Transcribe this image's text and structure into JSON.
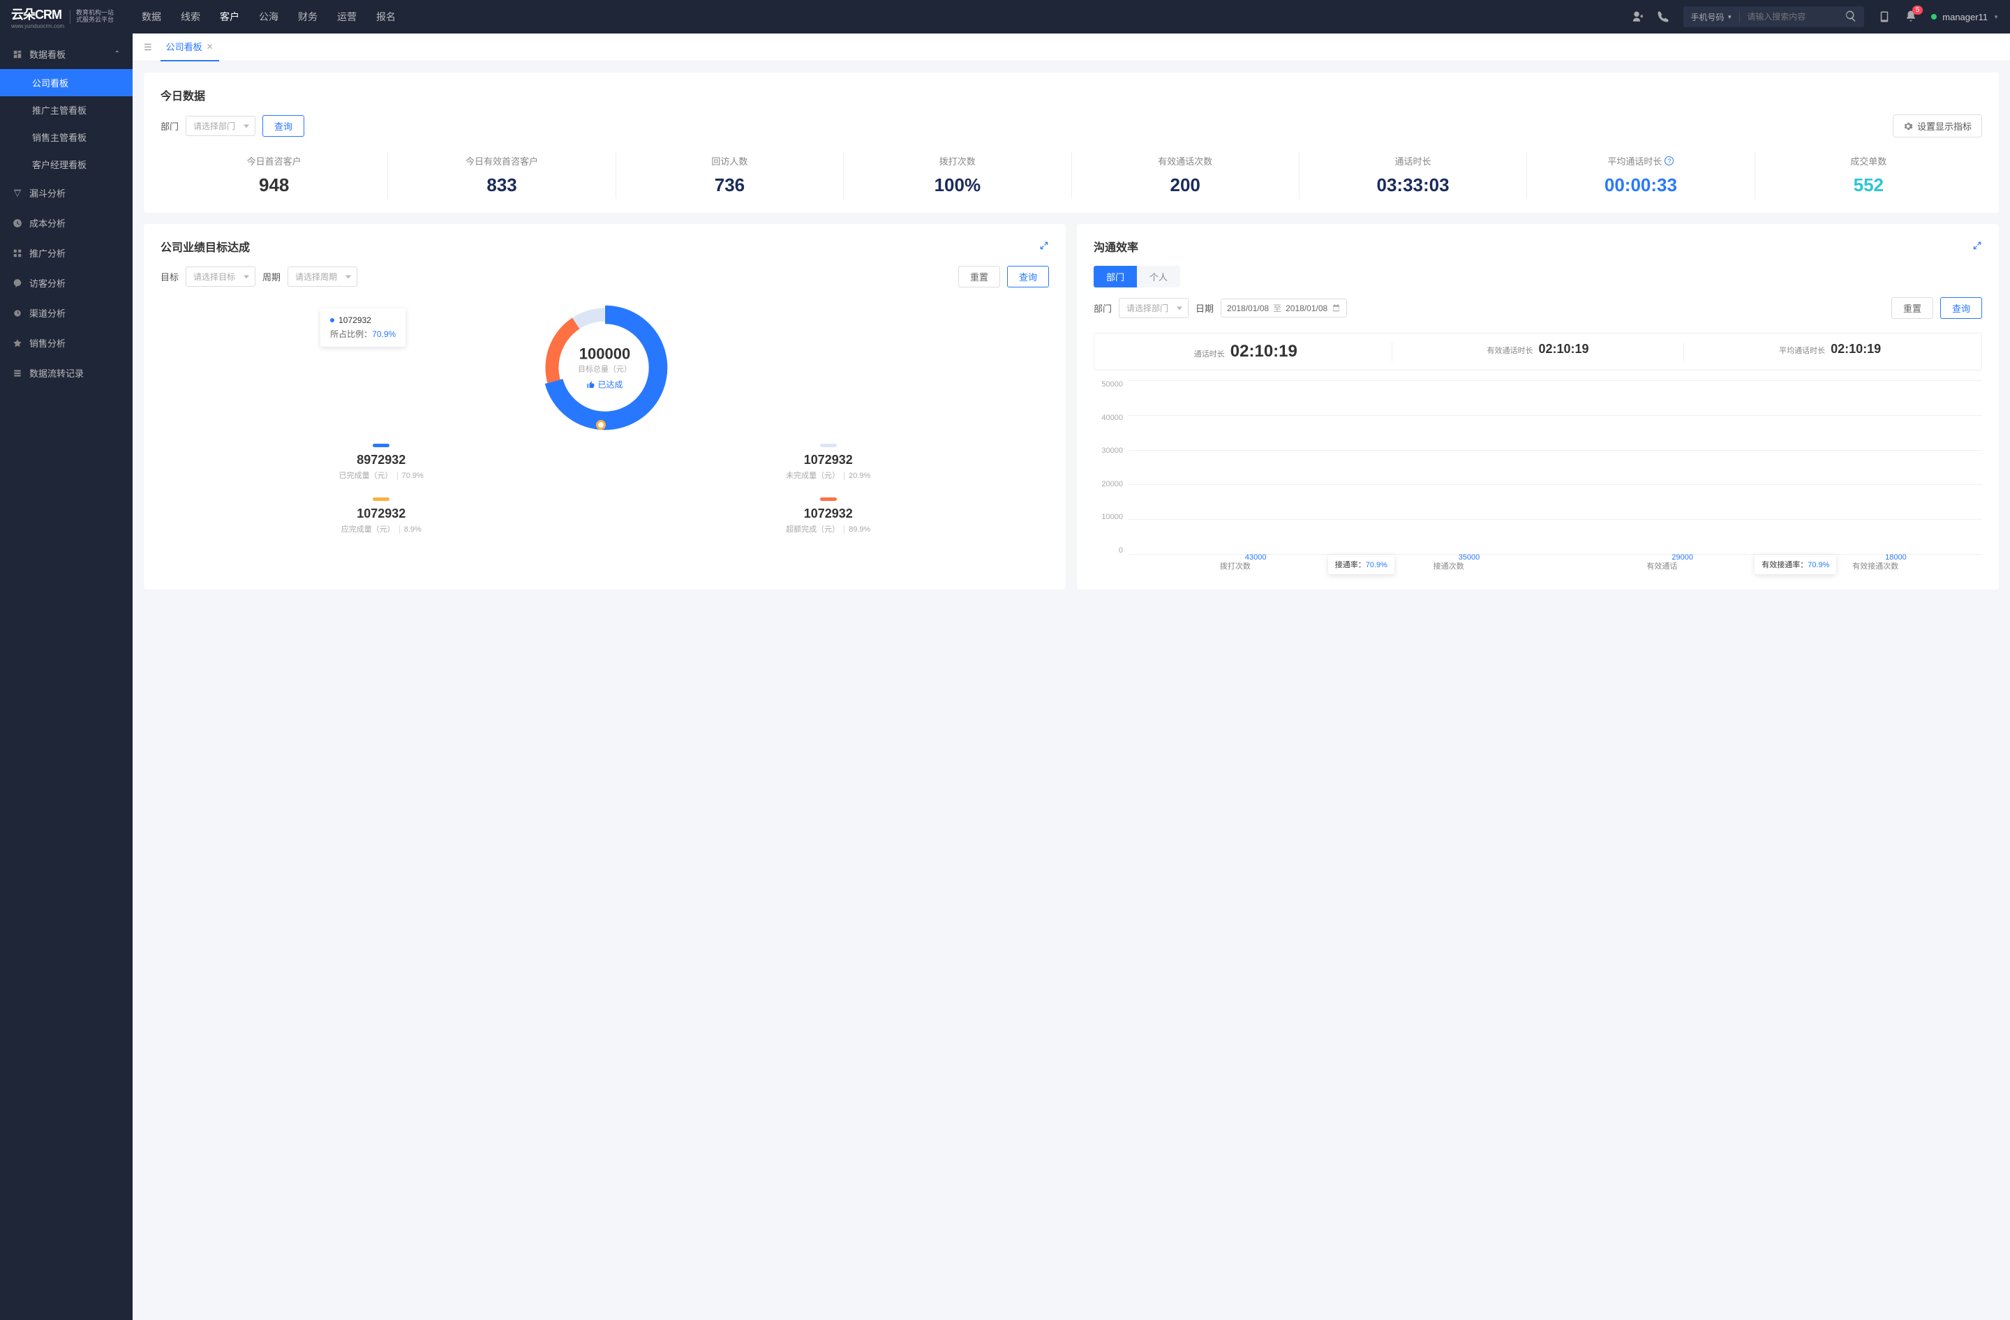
{
  "header": {
    "logo": "云朵CRM",
    "logo_url": "www.yunduocrm.com",
    "logo_sub1": "教育机构一站",
    "logo_sub2": "式服务云平台",
    "nav": [
      "数据",
      "线索",
      "客户",
      "公海",
      "财务",
      "运营",
      "报名"
    ],
    "nav_active": 2,
    "search_type": "手机号码",
    "search_placeholder": "请输入搜索内容",
    "badge": "5",
    "user": "manager11"
  },
  "sidebar": {
    "group": "数据看板",
    "subs": [
      "公司看板",
      "推广主管看板",
      "销售主管看板",
      "客户经理看板"
    ],
    "active_sub": 0,
    "items": [
      {
        "label": "漏斗分析"
      },
      {
        "label": "成本分析"
      },
      {
        "label": "推广分析"
      },
      {
        "label": "访客分析"
      },
      {
        "label": "渠道分析"
      },
      {
        "label": "销售分析"
      },
      {
        "label": "数据流转记录"
      }
    ]
  },
  "tabs": [
    {
      "label": "公司看板"
    }
  ],
  "today": {
    "title": "今日数据",
    "dept_label": "部门",
    "dept_placeholder": "请选择部门",
    "query": "查询",
    "settings": "设置显示指标",
    "metrics": [
      {
        "label": "今日首咨客户",
        "value": "948",
        "color": "#333"
      },
      {
        "label": "今日有效首咨客户",
        "value": "833",
        "color": "#1a2b5c"
      },
      {
        "label": "回访人数",
        "value": "736",
        "color": "#1a2b5c"
      },
      {
        "label": "拨打次数",
        "value": "100%",
        "color": "#1a2b5c"
      },
      {
        "label": "有效通话次数",
        "value": "200",
        "color": "#1a2b5c"
      },
      {
        "label": "通话时长",
        "value": "03:33:03",
        "color": "#1a2b5c"
      },
      {
        "label": "平均通话时长",
        "value": "00:00:33",
        "color": "#2878ff",
        "help": true
      },
      {
        "label": "成交单数",
        "value": "552",
        "color": "#2bc6d6"
      }
    ]
  },
  "target": {
    "title": "公司业绩目标达成",
    "goal_label": "目标",
    "goal_placeholder": "请选择目标",
    "period_label": "周期",
    "period_placeholder": "请选择周期",
    "reset": "重置",
    "query": "查询",
    "tooltip_value": "1072932",
    "tooltip_ratio_label": "所占比例：",
    "tooltip_ratio_value": "70.9%",
    "center_value": "100000",
    "center_label": "目标总量（元）",
    "status": "已达成",
    "items": [
      {
        "pill": "#2878ff",
        "value": "8972932",
        "label": "已完成量（元）",
        "pct": "70.9%"
      },
      {
        "pill": "#dbe5f5",
        "value": "1072932",
        "label": "未完成量（元）",
        "pct": "20.9%"
      },
      {
        "pill": "#fbb040",
        "value": "1072932",
        "label": "应完成量（元）",
        "pct": "8.9%"
      },
      {
        "pill": "#ff7043",
        "value": "1072932",
        "label": "超额完成（元）",
        "pct": "89.9%"
      }
    ]
  },
  "comm": {
    "title": "沟通效率",
    "seg": [
      "部门",
      "个人"
    ],
    "seg_active": 0,
    "dept_label": "部门",
    "dept_placeholder": "请选择部门",
    "date_label": "日期",
    "date_from": "2018/01/08",
    "date_to": "2018/01/08",
    "date_sep": "至",
    "reset": "重置",
    "query": "查询",
    "calls": [
      {
        "label": "通话时长",
        "value": "02:10:19"
      },
      {
        "label": "有效通话时长",
        "value": "02:10:19"
      },
      {
        "label": "平均通话时长",
        "value": "02:10:19"
      }
    ],
    "chart": {
      "y_max": 50000,
      "y_ticks": [
        "50000",
        "40000",
        "30000",
        "20000",
        "10000",
        "0"
      ],
      "bars": [
        {
          "label": "拨打次数",
          "value": 43000,
          "display": "43000",
          "light": false
        },
        {
          "label": "接通次数",
          "value": 35000,
          "display": "35000",
          "light": false,
          "tip_label": "接通率：",
          "tip_value": "70.9%"
        },
        {
          "label": "有效通话",
          "value": 29000,
          "display": "29000",
          "light": false
        },
        {
          "label": "有效接通次数",
          "value": 18000,
          "display": "18000",
          "light": true,
          "tip_label": "有效接通率：",
          "tip_value": "70.9%"
        }
      ]
    }
  },
  "chart_data": [
    {
      "type": "pie",
      "title": "公司业绩目标达成",
      "center_metric": {
        "label": "目标总量（元）",
        "value": 100000,
        "status": "已达成"
      },
      "series": [
        {
          "name": "已完成量（元）",
          "value": 8972932,
          "pct": 70.9,
          "color": "#2878ff"
        },
        {
          "name": "未完成量（元）",
          "value": 1072932,
          "pct": 20.9,
          "color": "#dbe5f5"
        },
        {
          "name": "应完成量（元）",
          "value": 1072932,
          "pct": 8.9,
          "color": "#fbb040"
        },
        {
          "name": "超额完成（元）",
          "value": 1072932,
          "pct": 89.9,
          "color": "#ff7043"
        }
      ],
      "tooltip": {
        "value": 1072932,
        "ratio": 70.9
      }
    },
    {
      "type": "bar",
      "title": "沟通效率",
      "categories": [
        "拨打次数",
        "接通次数",
        "有效通话",
        "有效接通次数"
      ],
      "values": [
        43000,
        35000,
        29000,
        18000
      ],
      "ylim": [
        0,
        50000
      ],
      "ylabel": "",
      "annotations": [
        {
          "category": "接通次数",
          "label": "接通率",
          "value": "70.9%"
        },
        {
          "category": "有效接通次数",
          "label": "有效接通率",
          "value": "70.9%"
        }
      ]
    }
  ]
}
